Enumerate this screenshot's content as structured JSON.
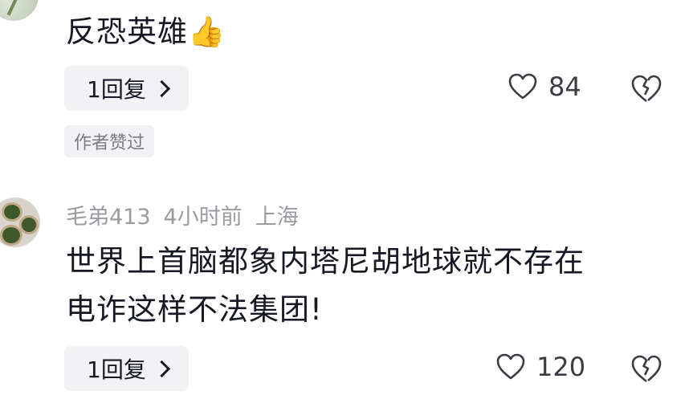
{
  "comments": [
    {
      "text": "反恐英雄👍",
      "reply_label": "1回复",
      "likes": "84",
      "author_badge": "作者赞过"
    },
    {
      "username": "毛弟413",
      "time": "4小时前",
      "location": "上海",
      "text_line1": "世界上首脑都象内塔尼胡地球就不存在",
      "text_line2": "电诈这样不法集团!",
      "reply_label": "1回复",
      "likes": "120"
    }
  ],
  "icons": {
    "like": "heart-outline-icon",
    "dislike": "broken-heart-icon",
    "thumbs_up": "thumbs-up-emoji"
  },
  "colors": {
    "text": "#161823",
    "muted": "#9a9ba1",
    "button_bg": "#f2f2f4"
  }
}
